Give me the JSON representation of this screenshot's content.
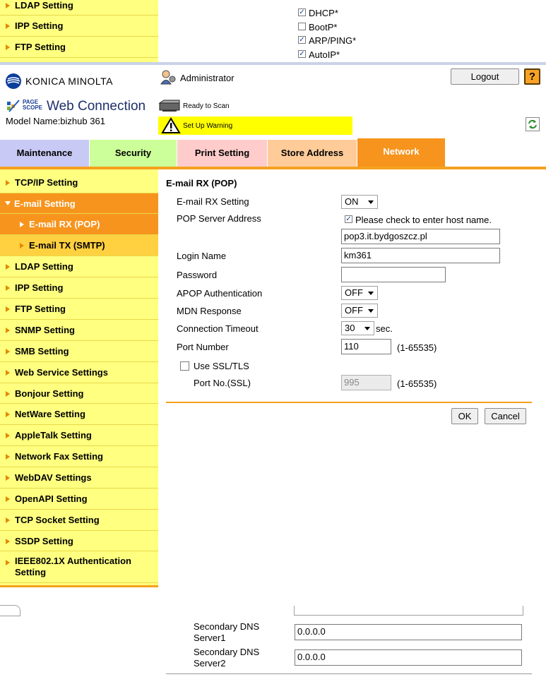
{
  "top_fragment": {
    "sidebar_items": [
      "LDAP Setting",
      "IPP Setting",
      "FTP Setting"
    ],
    "checkboxes": [
      {
        "label": "DHCP*",
        "checked": true
      },
      {
        "label": "BootP*",
        "checked": false
      },
      {
        "label": "ARP/PING*",
        "checked": true
      },
      {
        "label": "AutoIP*",
        "checked": true
      }
    ]
  },
  "header": {
    "brand": "KONICA MINOLTA",
    "pagescope_logo": "PAGE SCOPE",
    "product": "Web Connection",
    "model": "Model Name:bizhub 361",
    "user": "Administrator",
    "logout": "Logout",
    "help": "?",
    "status_ready": "Ready to Scan",
    "status_warning": "Set Up Warning"
  },
  "tabs": [
    "Maintenance",
    "Security",
    "Print Setting",
    "Store Address",
    "Network"
  ],
  "sidebar": {
    "items": [
      "TCP/IP Setting",
      "E-mail Setting",
      "E-mail RX (POP)",
      "E-mail TX (SMTP)",
      "LDAP Setting",
      "IPP Setting",
      "FTP Setting",
      "SNMP Setting",
      "SMB Setting",
      "Web Service Settings",
      "Bonjour Setting",
      "NetWare Setting",
      "AppleTalk Setting",
      "Network Fax Setting",
      "WebDAV Settings",
      "OpenAPI Setting",
      "TCP Socket Setting",
      "SSDP Setting",
      "IEEE802.1X Authentication Setting"
    ]
  },
  "form": {
    "title": "E-mail RX (POP)",
    "rx_setting_label": "E-mail RX Setting",
    "rx_setting_value": "ON",
    "pop_server_label": "POP Server Address",
    "host_check_label": "Please check to enter host name.",
    "pop_server_value": "pop3.it.bydgoszcz.pl",
    "login_label": "Login Name",
    "login_value": "km361",
    "password_label": "Password",
    "apop_label": "APOP Authentication",
    "apop_value": "OFF",
    "mdn_label": "MDN Response",
    "mdn_value": "OFF",
    "timeout_label": "Connection Timeout",
    "timeout_value": "30",
    "timeout_unit": "sec.",
    "port_label": "Port Number",
    "port_value": "110",
    "port_range": "(1-65535)",
    "ssl_label": "Use SSL/TLS",
    "ssl_port_label": "Port No.(SSL)",
    "ssl_port_value": "995",
    "ssl_port_range": "(1-65535)",
    "ok": "OK",
    "cancel": "Cancel"
  },
  "bottom_fragment": {
    "dns1_label_a": "Secondary DNS",
    "dns1_label_b": "Server1",
    "dns1_value": "0.0.0.0",
    "dns2_label_a": "Secondary DNS",
    "dns2_label_b": "Server2",
    "dns2_value": "0.0.0.0"
  },
  "colors": {
    "tab_maintenance": "#c9c9f5",
    "tab_security": "#ccff99",
    "tab_print": "#ffcccc",
    "tab_store": "#ffcc99",
    "tab_network": "#f7941d",
    "sidebar": "#ffff80",
    "sidebar_selected": "#f7941d",
    "sidebar_sub": "#ffd040",
    "warning": "#ffff00"
  }
}
